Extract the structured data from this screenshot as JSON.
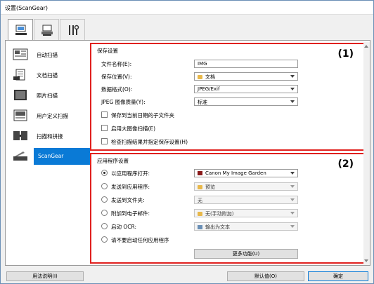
{
  "window": {
    "title": "设置(ScanGear)"
  },
  "tabs": [
    {
      "name": "scan-tab",
      "icon": "computer-scan-icon",
      "active": true
    },
    {
      "name": "network-tab",
      "icon": "network-scanner-icon",
      "active": false
    },
    {
      "name": "tools-tab",
      "icon": "tools-icon",
      "active": false
    }
  ],
  "sidebar": {
    "items": [
      {
        "label": "自动扫描",
        "icon": "auto-scan-icon"
      },
      {
        "label": "文档扫描",
        "icon": "document-scan-icon"
      },
      {
        "label": "照片扫描",
        "icon": "photo-scan-icon"
      },
      {
        "label": "用户定义扫描",
        "icon": "custom-scan-icon"
      },
      {
        "label": "扫描和拼接",
        "icon": "stitch-scan-icon"
      },
      {
        "label": "ScanGear",
        "icon": "scangear-icon",
        "selected": true
      }
    ]
  },
  "save_settings": {
    "header": "保存设置",
    "number": "(1)",
    "file_name_label": "文件名称(E):",
    "file_name_value": "IMG",
    "save_in_label": "保存位置(V):",
    "save_in_value": "文档",
    "format_label": "数据格式(O):",
    "format_value": "JPEG/Exif",
    "jpeg_quality_label": "JPEG 图像质量(Y):",
    "jpeg_quality_value": "标准",
    "check_subfolder": "保存到当前日期的子文件夹",
    "check_large": "启用大图像扫描(E)",
    "check_verify": "检查扫描结果并指定保存设置(H)"
  },
  "app_settings": {
    "header": "应用程序设置",
    "number": "(2)",
    "open_app_label": "以应用程序打开:",
    "open_app_value": "Canon My Image Garden",
    "send_app_label": "发送到应用程序:",
    "send_app_value": "预览",
    "send_folder_label": "发送到文件夹:",
    "send_folder_value": "无",
    "attach_email_label": "附加到电子邮件:",
    "attach_email_value": "无(手动附加)",
    "ocr_label": "启动 OCR:",
    "ocr_value": "输出为文本",
    "no_app_label": "请不要启动任何应用程序",
    "more_functions": "更多功能(U)"
  },
  "footer": {
    "instructions": "用法说明(I)",
    "defaults": "默认值(O)",
    "ok": "确定"
  },
  "colors": {
    "highlight": "#e0201e",
    "selection": "#0a7ad6"
  }
}
